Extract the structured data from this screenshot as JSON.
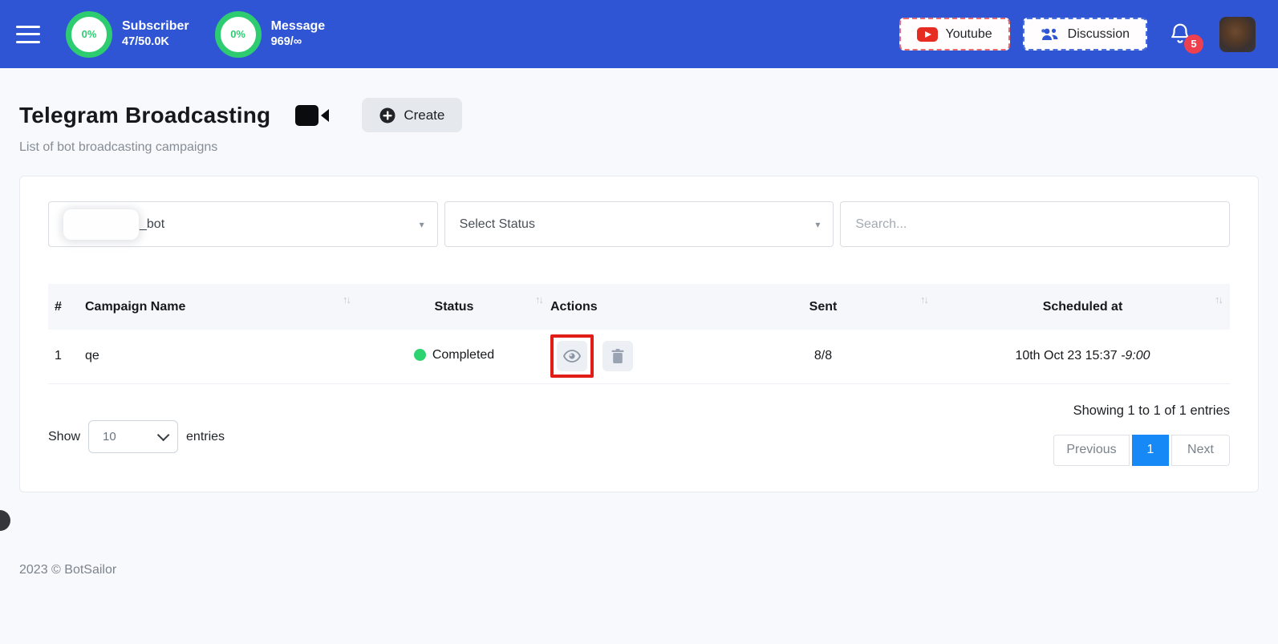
{
  "header": {
    "stats": [
      {
        "percent": "0%",
        "label": "Subscriber",
        "value": "47/50.0K"
      },
      {
        "percent": "0%",
        "label": "Message",
        "value": "969/∞"
      }
    ],
    "youtube_label": "Youtube",
    "discussion_label": "Discussion",
    "notification_count": "5"
  },
  "page": {
    "title": "Telegram Broadcasting",
    "subtitle": "List of bot broadcasting campaigns",
    "create_label": "Create"
  },
  "filters": {
    "bot_select_value": "_bot",
    "status_select_placeholder": "Select Status",
    "search_placeholder": "Search...",
    "caret_glyph": "▾"
  },
  "table": {
    "columns": [
      "#",
      "Campaign Name",
      "Status",
      "Actions",
      "Sent",
      "Scheduled at"
    ],
    "sort_glyph": "↑↓",
    "rows": [
      {
        "index": "1",
        "name": "qe",
        "status": "Completed",
        "sent": "8/8",
        "scheduled_date": "10th Oct 23 15:37 ",
        "scheduled_offset": "-9:00"
      }
    ]
  },
  "footer_controls": {
    "show_label": "Show",
    "entries_per_page": "10",
    "entries_label": "entries",
    "summary": "Showing 1 to 1 of 1 entries",
    "previous_label": "Previous",
    "current_page": "1",
    "next_label": "Next"
  },
  "footer": {
    "copyright": "2023 © BotSailor"
  },
  "colors": {
    "header_bg": "#2f55d4",
    "ring_green": "#2ecc71",
    "badge_red": "#ef4050",
    "status_green": "#2dd36f",
    "active_page_blue": "#1789f7",
    "highlight_red": "#e21d17"
  }
}
